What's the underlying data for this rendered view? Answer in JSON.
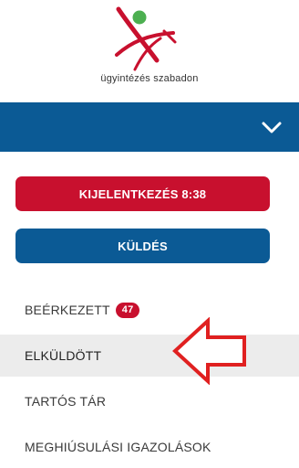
{
  "logo": {
    "tagline": "ügyintézés szabadon",
    "colors": {
      "mark": "#c8102e",
      "dot": "#4caf50"
    }
  },
  "nav": {
    "toggle_icon": "chevron-down-icon",
    "background": "#0b5a95"
  },
  "buttons": {
    "logout_label": "KIJELENTKEZÉS 8:38",
    "send_label": "KÜLDÉS"
  },
  "menu": {
    "inbox_label": "BEÉRKEZETT",
    "inbox_count": "47",
    "sent_label": "ELKÜLDÖTT",
    "storage_label": "TARTÓS TÁR",
    "failed_label": "MEGHIÚSULÁSI IGAZOLÁSOK"
  },
  "annotation": {
    "icon": "left-arrow-outline-icon",
    "color": "#e02020"
  }
}
